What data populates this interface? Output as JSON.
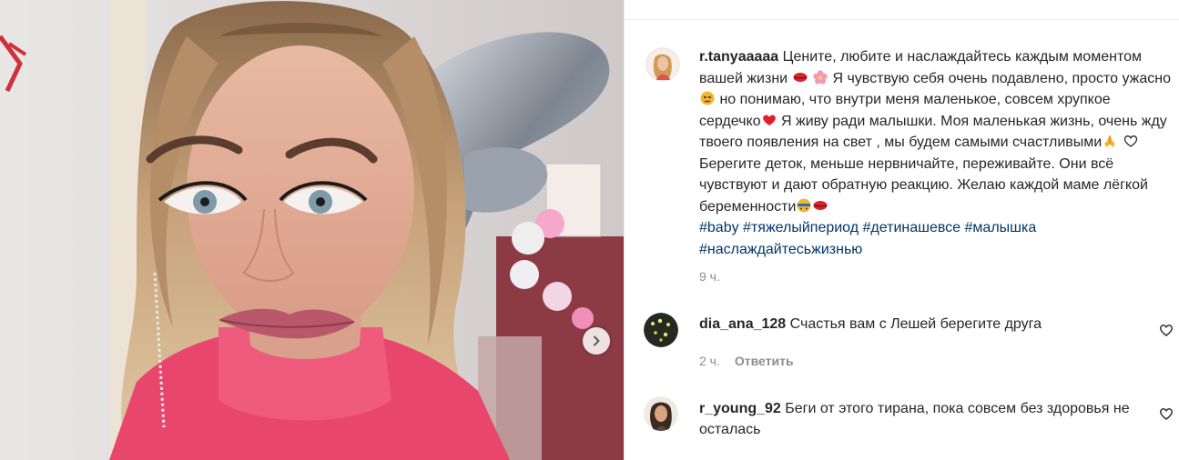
{
  "post": {
    "author": "r.tanyaaaaa",
    "caption_parts": {
      "p1": "Цените, любите и наслаждайтесь каждым моментом вашей жизни",
      "p2": "Я чувствую себя очень подавлено, просто ужасно",
      "p3": "но понимаю, что внутри меня маленькое, совсем хрупкое сердечко",
      "p4": "Я живу ради малышки. Моя маленькая жизнь, очень жду твоего появления на свет , мы будем самыми счастливыми",
      "p5": "Берегите деток, меньше нервничайте, переживайте. Они всё чувствуют и дают обратную реакцию. Желаю каждой маме лёгкой беременности"
    },
    "hashtags": [
      "#baby",
      "#тяжелыйпериод",
      "#детинашевсе",
      "#малышка",
      "#наслаждайтесьжизнью"
    ],
    "time": "9 ч.",
    "next_icon": "chevron-right-icon"
  },
  "comments": [
    {
      "username": "dia_ana_128",
      "text": "Счастья вам с Лешей берегите друга",
      "time": "2 ч.",
      "reply_label": "Ответить"
    },
    {
      "username": "r_young_92",
      "text": "Беги от этого тирана, пока совсем без здоровья не осталась"
    }
  ],
  "colors": {
    "hashtag": "#00376b",
    "muted": "#8e8e8e",
    "text": "#262626"
  }
}
